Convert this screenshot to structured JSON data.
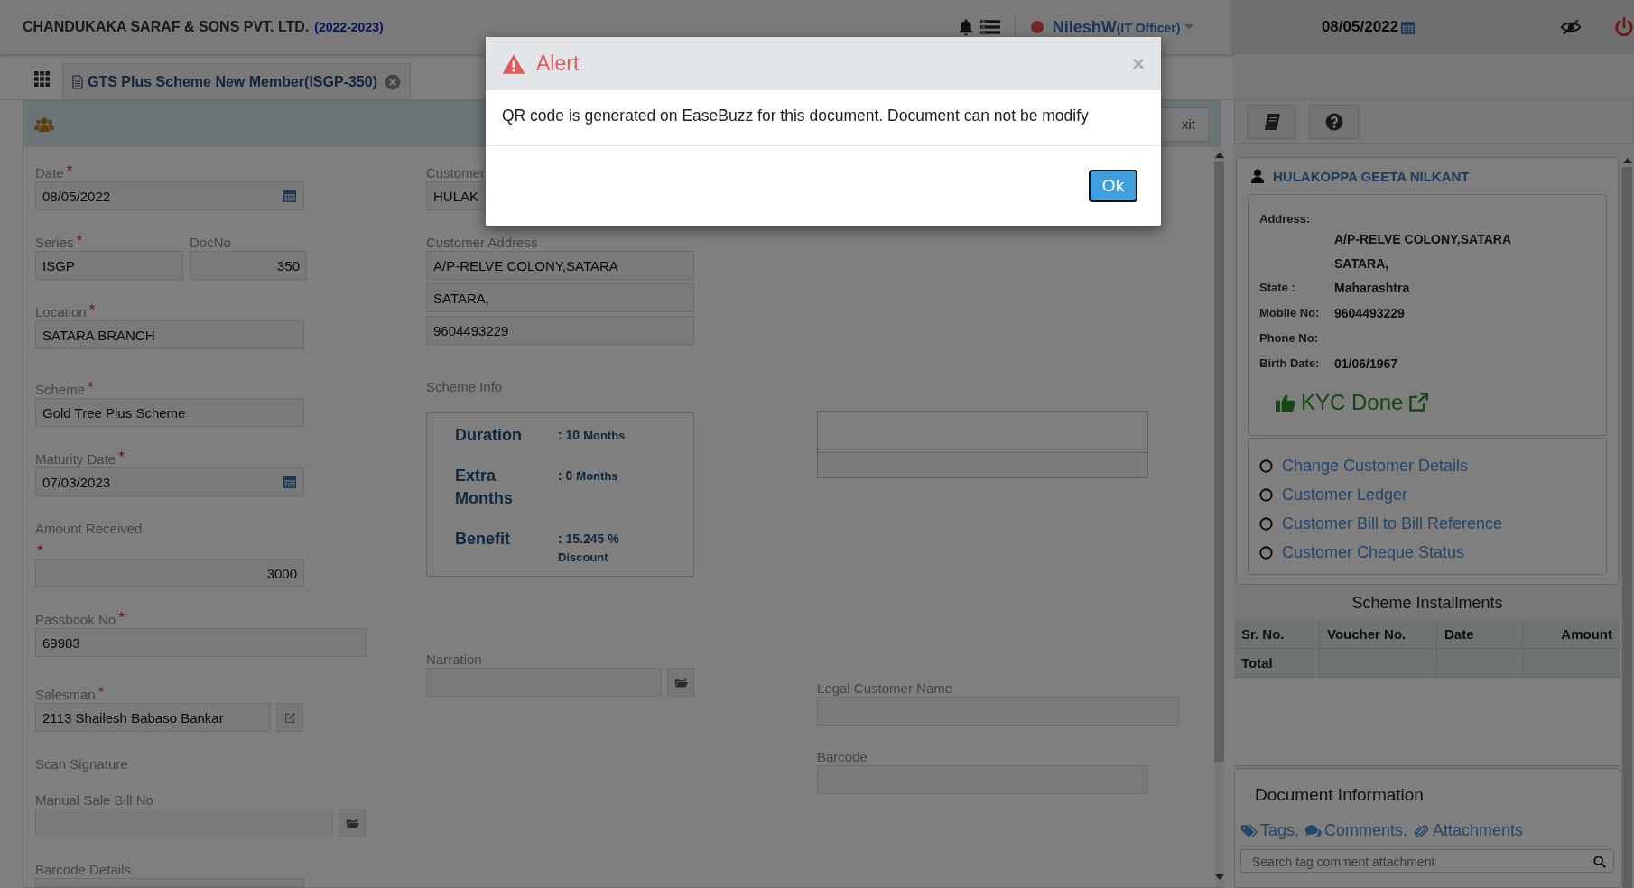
{
  "header": {
    "company": "CHANDUKAKA SARAF & SONS PVT. LTD.",
    "fiscal_year": "(2022-2023)",
    "user": "NileshW",
    "role": "(IT Officer)",
    "date": "08/05/2022"
  },
  "tabs": [
    {
      "label": "GTS Plus Scheme New Member(ISGP-350)",
      "selected": true
    }
  ],
  "toolbar": {
    "exit": "xit"
  },
  "form": {
    "date": {
      "label": "Date",
      "required_mark": "*",
      "value": "08/05/2022"
    },
    "series": {
      "label": "Series",
      "required_mark": "*",
      "value": "ISGP"
    },
    "doc_no": {
      "label": "DocNo",
      "value": "350"
    },
    "location": {
      "label": "Location",
      "required_mark": "*",
      "value": "SATARA BRANCH"
    },
    "scheme": {
      "label": "Scheme",
      "required_mark": "*",
      "value": "Gold Tree Plus Scheme"
    },
    "maturity_date": {
      "label": "Maturity Date",
      "required_mark": "*",
      "value": "07/03/2023"
    },
    "amount_received": {
      "label": "Amount Received",
      "required_mark": "*",
      "value": "3000"
    },
    "passbook_no": {
      "label": "Passbook No",
      "required_mark": "*",
      "value": "69983"
    },
    "salesman": {
      "label": "Salesman",
      "required_mark": "*",
      "value": "2113 Shailesh Babaso Bankar"
    },
    "scan_signature": {
      "label": "Scan Signature"
    },
    "manual_sale_bill_no": {
      "label": "Manual Sale Bill No"
    },
    "barcode_details": {
      "label": "Barcode Details"
    },
    "customer": {
      "label": "Customer",
      "value": "HULAK"
    },
    "customer_address": {
      "label": "Customer Address",
      "lines": [
        "A/P-RELVE COLONY,SATARA",
        "SATARA,",
        "9604493229"
      ]
    },
    "scheme_info": {
      "label": "Scheme Info",
      "items": [
        {
          "term": "Duration",
          "value": ": 10",
          "unit": "Months"
        },
        {
          "term": "Extra Months",
          "value": ": 0",
          "unit": "Months"
        },
        {
          "term": "Benefit",
          "value": ": 15.245 %",
          "unit": "Discount"
        }
      ]
    },
    "narration": {
      "label": "Narration"
    },
    "legal_customer_name": {
      "label": "Legal Customer Name"
    },
    "barcode": {
      "label": "Barcode"
    }
  },
  "customer_card": {
    "name": "HULAKOPPA GEETA NILKANT",
    "details": [
      {
        "label": "Address:",
        "values": [
          "A/P-RELVE COLONY,SATARA",
          "SATARA,"
        ]
      },
      {
        "label": "State :",
        "values": [
          "Maharashtra"
        ]
      },
      {
        "label": "Mobile No:",
        "values": [
          "9604493229"
        ]
      },
      {
        "label": "Phone No:"
      },
      {
        "label": "Birth Date:",
        "values": [
          "01/06/1967"
        ]
      }
    ],
    "kyc": "KYC Done",
    "links": [
      {
        "label": "Change Customer Details",
        "selected": false
      },
      {
        "label": "Customer Ledger",
        "selected": false
      },
      {
        "label": "Customer Bill to Bill Reference",
        "selected": false
      },
      {
        "label": "Customer Cheque Status",
        "selected": false
      }
    ]
  },
  "installments": {
    "title": "Scheme Installments",
    "columns": [
      "Sr. No.",
      "Voucher No.",
      "Date",
      "Amount"
    ],
    "total_label": "Total"
  },
  "document_info": {
    "title": "Document Information",
    "links": [
      "Tags,",
      "Comments,",
      "Attachments"
    ],
    "search_placeholder": "Search tag comment attachment"
  },
  "alert": {
    "title": "Alert",
    "close": "×",
    "message": "QR code is generated on EaseBuzz for this document. Document can not be modify",
    "button": "Ok"
  }
}
